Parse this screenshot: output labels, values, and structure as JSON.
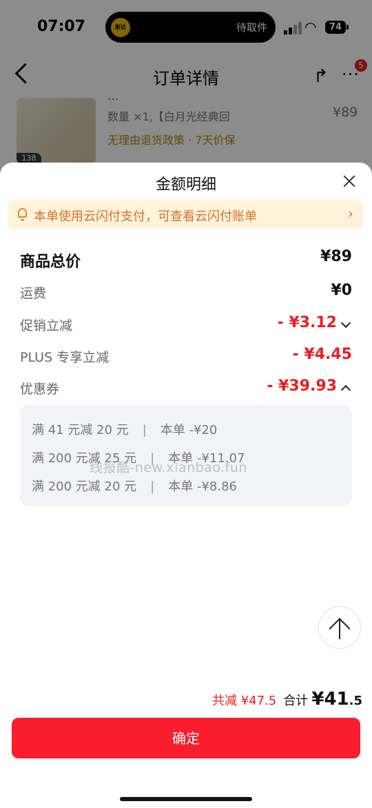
{
  "status_bar": {
    "time": "07:07",
    "island_app_logo": "斯达",
    "island_text": "待取件",
    "battery": "74"
  },
  "nav": {
    "title": "订单详情",
    "badge_count": "5"
  },
  "product": {
    "line1": "...",
    "quantity": "数量 ×1,【白月光经典回",
    "price": "¥89",
    "policy": "无理由退货政策 · 7天价保",
    "thumb_tag": "138"
  },
  "sheet": {
    "title": "金额明细",
    "notice": "本单使用云闪付支付，可查看云闪付账单",
    "rows": [
      {
        "label": "商品总价",
        "value": "¥89"
      },
      {
        "label": "运费",
        "value": "¥0"
      },
      {
        "label": "促销立减",
        "value": "- ¥3.12"
      },
      {
        "label": "PLUS 专享立减",
        "value": "- ¥4.45"
      },
      {
        "label": "优惠券",
        "value": "- ¥39.93"
      }
    ],
    "coupons": [
      {
        "rule": "满 41 元减 20 元",
        "applied": "本单 -¥20"
      },
      {
        "rule": "满 200 元减 25 元",
        "applied": "本单 -¥11.07"
      },
      {
        "rule": "满 200 元减 20 元",
        "applied": "本单 -¥8.86"
      }
    ],
    "watermark": "线报酷-new.xianbao.fun",
    "summary": {
      "saved": "共减 ¥47.5",
      "total_label": "合计",
      "total_currency": "¥",
      "total_main": "41",
      "total_decimal": ".5"
    },
    "confirm_label": "确定"
  },
  "colors": {
    "accent_red": "#fa1d2d",
    "price_red": "#e62020",
    "notice_bg": "#fff3dc",
    "notice_text": "#d9702a"
  },
  "icons": [
    "back-icon",
    "share-icon",
    "more-icon",
    "close-icon",
    "bell-icon",
    "chevron-right-icon",
    "chevron-down-icon",
    "chevron-up-icon",
    "arrow-up-icon"
  ]
}
